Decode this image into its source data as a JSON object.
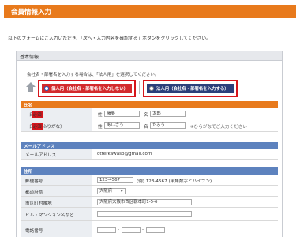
{
  "header": {
    "title": "会員情報入力"
  },
  "intro_text": "以下のフォームにご入力いただき、「次へ・入力内容を確認する」ボタンをクリックしてください。",
  "panel": {
    "title": "基本情報",
    "note": "会社名・部署名を入力する場合は、「法人用」を選択してください。",
    "options": [
      {
        "label": "個人用（会社名・部署名を入力しない）",
        "selected": true
      },
      {
        "label": "法人用（会社名・部署名を入力する）",
        "selected": false
      }
    ]
  },
  "sections": {
    "name": "氏名",
    "email": "メールアドレス",
    "address": "住所"
  },
  "name_rows": {
    "name_label": "氏名",
    "kana_label": "氏名（ふりがな）",
    "required": "必須",
    "sei_label": "姓",
    "mei_label": "名",
    "sei_value": "擁夢",
    "mei_value": "太郎",
    "sei_kana_value": "あいさう",
    "mei_kana_value": "たろう",
    "kana_hint": "※ひらがなでご入力ください"
  },
  "email_row": {
    "label": "メールアドレス",
    "value": "otterkawaso@gmail.com"
  },
  "address_rows": {
    "postal_label": "郵便番号",
    "postal_value": "123-4567",
    "postal_hint": "(例) 123-4567 (半角数字とハイフン)",
    "pref_label": "都道府県",
    "pref_value": "大阪府",
    "city_label": "市区町村番地",
    "city_value": "大阪府大阪市西区靱本町1-5-6",
    "building_label": "ビル・マンション名など",
    "phone_label": "電話番号",
    "phone_sep": "-"
  },
  "colors": {
    "orange": "#e87a1c",
    "red_option": "#d32a2d",
    "navy_option": "#2c3f7a",
    "blue_section": "#5d82be",
    "highlight": "#d6151b"
  }
}
